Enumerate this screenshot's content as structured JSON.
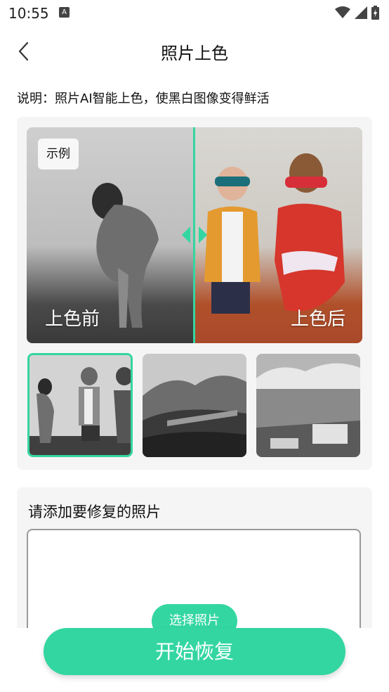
{
  "status_bar": {
    "time": "10:55",
    "notification_icon": "a-notification-icon",
    "wifi_icon": "wifi-icon",
    "signal_icon": "signal-icon",
    "battery_icon": "battery-charging-icon"
  },
  "header": {
    "back_icon": "chevron-left-icon",
    "title": "照片上色"
  },
  "description": "说明：照片AI智能上色，使黑白图像变得鲜活",
  "example": {
    "tag": "示例",
    "before_label": "上色前",
    "after_label": "上色后",
    "divider_color": "#33d6a1",
    "thumbnails": [
      "children-photo",
      "viaduct-landscape-photo",
      "coastal-town-photo"
    ],
    "selected_thumbnail": 0
  },
  "upload": {
    "title": "请添加要修复的照片",
    "select_button": "选择照片"
  },
  "actions": {
    "start_button": "开始恢复"
  },
  "colors": {
    "accent": "#33d6a1",
    "card_bg": "#f5f5f5"
  }
}
